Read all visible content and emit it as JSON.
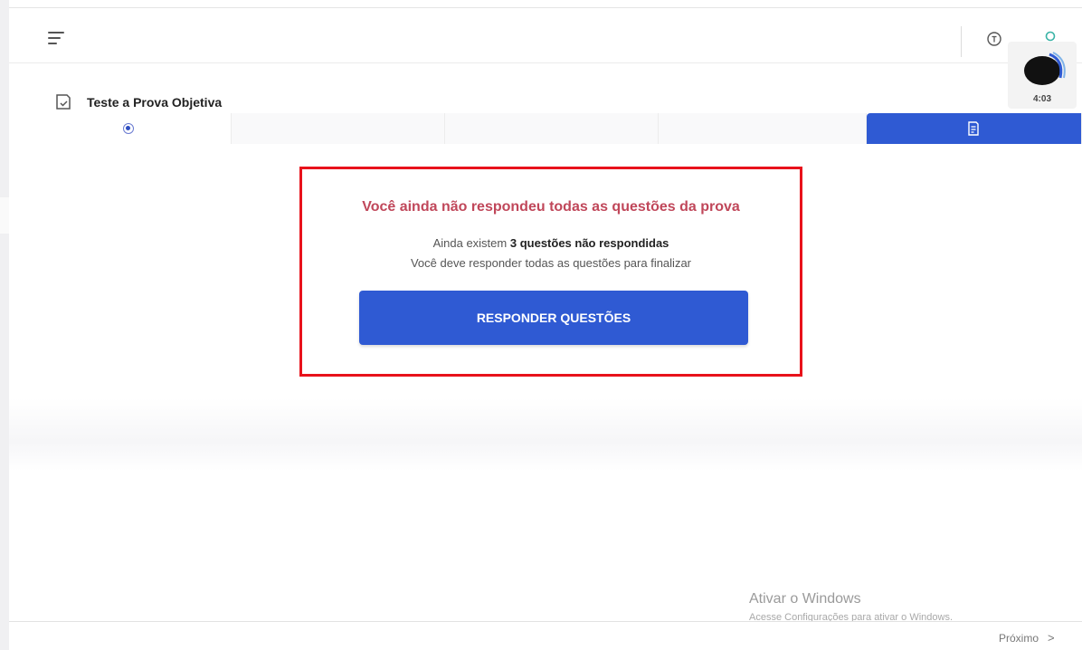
{
  "header": {
    "menu_icon": "hamburger-menu-icon",
    "info_icon": "info-circle-icon",
    "user_icon": "user-icon"
  },
  "timer": {
    "time": "4:03"
  },
  "exam": {
    "title": "Teste a Prova Objetiva",
    "title_icon": "document-check-icon"
  },
  "steps": {
    "active_icon": "radio-selected-icon",
    "finish_icon": "finish-document-icon"
  },
  "alert": {
    "title": "Você ainda não respondeu todas as questões da prova",
    "line1_prefix": "Ainda existem",
    "line1_bold": "3 questões não respondidas",
    "line2": "Você deve responder todas as questões para finalizar",
    "button_label": "RESPONDER QUESTÕES"
  },
  "windows_watermark": {
    "title": "Ativar o Windows",
    "subtitle": "Acesse Configurações para ativar o Windows."
  },
  "footer": {
    "next_label": "Próximo",
    "next_icon": "chevron-right-icon"
  },
  "colors": {
    "primary": "#2f5ad3",
    "alert_title": "#c0475a",
    "highlight_border": "#e8121b"
  }
}
